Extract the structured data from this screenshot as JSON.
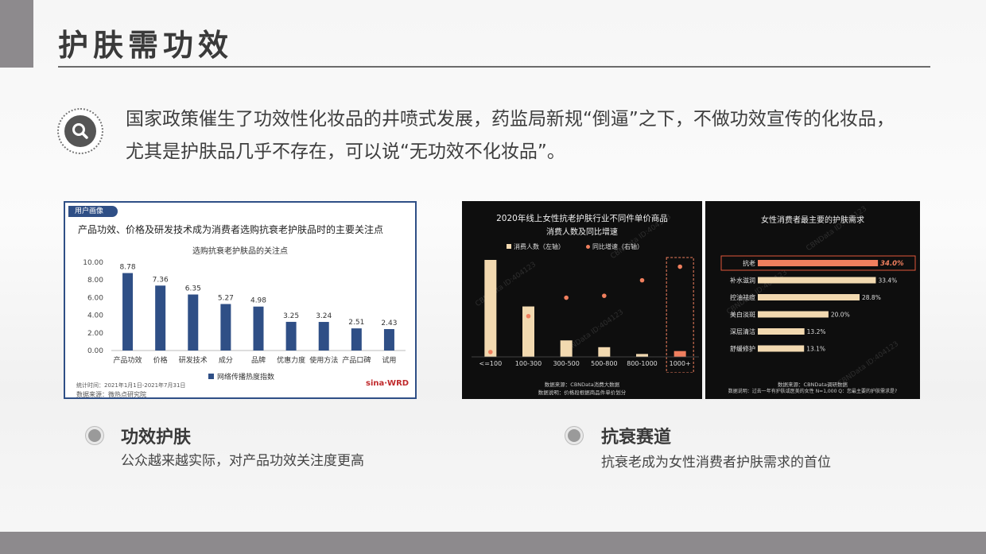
{
  "page": {
    "title": "护肤需功效",
    "intro_line1": "国家政策催生了功效性化妆品的井喷式发展，药监局新规“倒逼”之下，不做功效宣传的化妆品，",
    "intro_line2": "尤其是护肤品几乎不存在，可以说“无功效不化妆品”。"
  },
  "card_left": {
    "tag": "用户画像",
    "heading": "产品功效、价格及研发技术成为消费者选购抗衰老护肤品时的主要关注点",
    "subtitle": "选购抗衰老护肤品的关注点",
    "legend": "网络传播热度指数",
    "footnote_period": "统计时间：2021年1月1日-2021年7月31日",
    "footnote_source": "数据来源：微热点研究院",
    "logo": "sina·WRD"
  },
  "card_mid": {
    "title": "2020年线上女性抗老护肤行业不同件单价商品",
    "subtitle": "消费人数及同比增速",
    "legend_bar": "消费人数（左轴）",
    "legend_dot": "同比增速（右轴）",
    "note1": "数据来源：CBNData消费大数据",
    "note2": "数据说明：价格段根据商品件单价划分"
  },
  "card_right": {
    "title": "女性消费者最主要的护肤需求",
    "note1": "数据来源：CBNData调研数据",
    "note2": "数据说明：过去一年有护肤或医美的女性 N=1,000 Q：您最主要的护肤需求是?"
  },
  "watermark": "CBNData ID:404123",
  "sections": [
    {
      "heading": "功效护肤",
      "desc": "公众越来越实际，对产品功效关注度更高"
    },
    {
      "heading": "抗衰赛道",
      "desc": "抗衰老成为女性消费者护肤需求的首位"
    }
  ],
  "colors": {
    "navy": "#2f4f86",
    "accent": "#f07f5e",
    "cream": "#f2d9b0"
  },
  "chart_data": [
    {
      "type": "bar",
      "title": "选购抗衰老护肤品的关注点",
      "categories": [
        "产品功效",
        "价格",
        "研发技术",
        "成分",
        "品牌",
        "优惠力度",
        "使用方法",
        "产品口碑",
        "试用"
      ],
      "series": [
        {
          "name": "网络传播热度指数",
          "values": [
            8.78,
            7.36,
            6.35,
            5.27,
            4.98,
            3.25,
            3.24,
            2.51,
            2.43
          ]
        }
      ],
      "value_labels": [
        "8.78",
        "7.36",
        "6.35",
        "5.27",
        "4.98",
        "3.25",
        "3.24",
        "2.51",
        "2.43"
      ],
      "ylim": [
        0,
        10
      ],
      "yticks": [
        "0.00",
        "2.00",
        "4.00",
        "6.00",
        "8.00",
        "10.00"
      ],
      "grid": false,
      "legend": "bottom"
    },
    {
      "type": "bar",
      "categories": [
        "<=100",
        "100-300",
        "300-500",
        "500-800",
        "800-1000",
        "1000+"
      ],
      "series": [
        {
          "name": "消费人数（左轴）",
          "values": [
            100,
            52,
            17,
            10,
            3,
            6
          ]
        },
        {
          "name": "同比增速（右轴）",
          "type": "scatter",
          "values": [
            5,
            42,
            61,
            63,
            79,
            93
          ]
        }
      ],
      "ylim": [
        0,
        100
      ],
      "y2lim": [
        0,
        100
      ],
      "highlight_category": "1000+",
      "legend": "top"
    },
    {
      "type": "bar",
      "orientation": "horizontal",
      "title": "女性消费者最主要的护肤需求",
      "categories": [
        "抗老",
        "补水滋润",
        "控油祛痘",
        "美白淡斑",
        "深层清洁",
        "舒缓修护"
      ],
      "values": [
        34.0,
        33.4,
        28.8,
        20.0,
        13.2,
        13.1
      ],
      "value_labels": [
        "34.0%",
        "33.4%",
        "28.8%",
        "20.0%",
        "13.2%",
        "13.1%"
      ],
      "xlim": [
        0,
        36
      ],
      "highlight_category": "抗老"
    }
  ]
}
